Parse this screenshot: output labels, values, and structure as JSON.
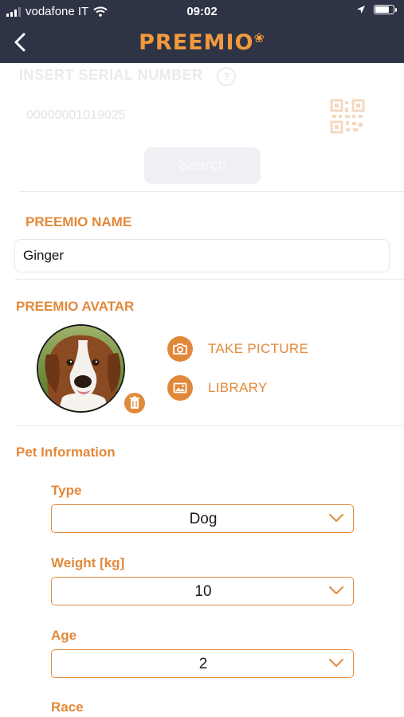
{
  "status_bar": {
    "carrier": "vodafone IT",
    "time": "09:02"
  },
  "header": {
    "logo_text": "PREEMIO",
    "back_icon": "chevron-left-icon"
  },
  "serial": {
    "label": "INSERT SERIAL NUMBER",
    "help_icon": "?",
    "value": "00000001019025",
    "qr_icon": "qr-code-icon",
    "search_label": "Search"
  },
  "name": {
    "title": "PREEMIO NAME",
    "value": "Ginger"
  },
  "avatar": {
    "title": "PREEMIO AVATAR",
    "take_picture": "TAKE PICTURE",
    "library": "LIBRARY",
    "camera_icon": "camera-icon",
    "library_icon": "image-icon",
    "delete_icon": "trash-icon"
  },
  "pet_info": {
    "title": "Pet Information",
    "type_label": "Type",
    "type_value": "Dog",
    "weight_label": "Weight [kg]",
    "weight_value": "10",
    "age_label": "Age",
    "age_value": "2",
    "race_label": "Race"
  },
  "colors": {
    "header_bg": "#2e3446",
    "accent": "#e2893a"
  }
}
